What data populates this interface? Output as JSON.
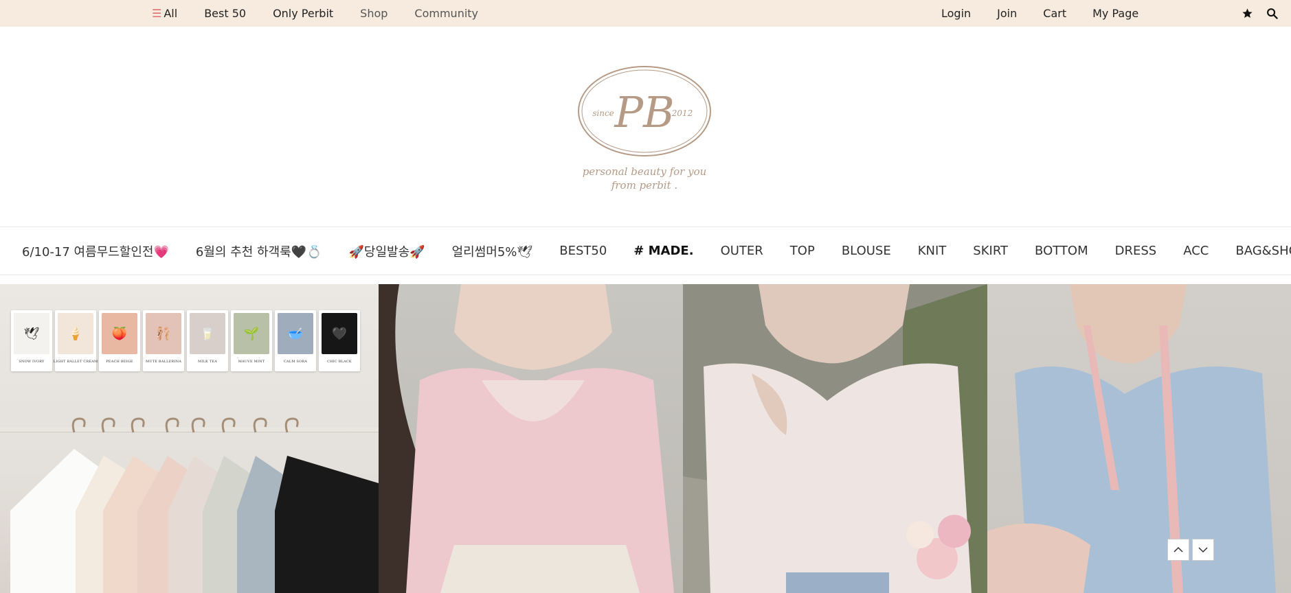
{
  "topbar": {
    "menu_all": "All",
    "nav": [
      "Best 50",
      "Only Perbit",
      "Shop",
      "Community"
    ],
    "account": [
      "Login",
      "Join",
      "Cart",
      "My Page"
    ],
    "icons": [
      "star-icon",
      "search-icon"
    ]
  },
  "logo": {
    "brand_letters": "PB",
    "since_left": "since",
    "since_right": "2012",
    "tagline_line1": "personal beauty for you",
    "tagline_line2": "from perbit ."
  },
  "categories": [
    "6/10-17 여름무드할인전💗",
    "6월의 추천 하객룩🖤💍",
    "🚀당일발송🚀",
    "얼리썸머5%🕊",
    "BEST50",
    "# MADE.",
    "OUTER",
    "TOP",
    "BLOUSE",
    "KNIT",
    "SKIRT",
    "BOTTOM",
    "DRESS",
    "ACC",
    "BAG&SHOES"
  ],
  "swatches": [
    {
      "label": "SNOW IVORY",
      "color": "#f4f2ee",
      "emoji": "🕊"
    },
    {
      "label": "LIGHT BALLET CREAM",
      "color": "#f2e6da",
      "emoji": "🍦"
    },
    {
      "label": "PEACH BEIGE",
      "color": "#e9b8a2",
      "emoji": "🍑"
    },
    {
      "label": "MUTE BALLERINA",
      "color": "#e3c3b8",
      "emoji": "🩰"
    },
    {
      "label": "MILK TEA",
      "color": "#d8cfca",
      "emoji": "🥛"
    },
    {
      "label": "MAUVE MINT",
      "color": "#b9c0a8",
      "emoji": "🌱"
    },
    {
      "label": "CALM SORA",
      "color": "#9eacbb",
      "emoji": "🥣"
    },
    {
      "label": "CHIC BLACK",
      "color": "#161616",
      "emoji": "🖤"
    }
  ],
  "colors": {
    "topbar_bg": "#f6ebde",
    "logo_tan": "#b59a86",
    "menu_icon": "#e07070"
  }
}
